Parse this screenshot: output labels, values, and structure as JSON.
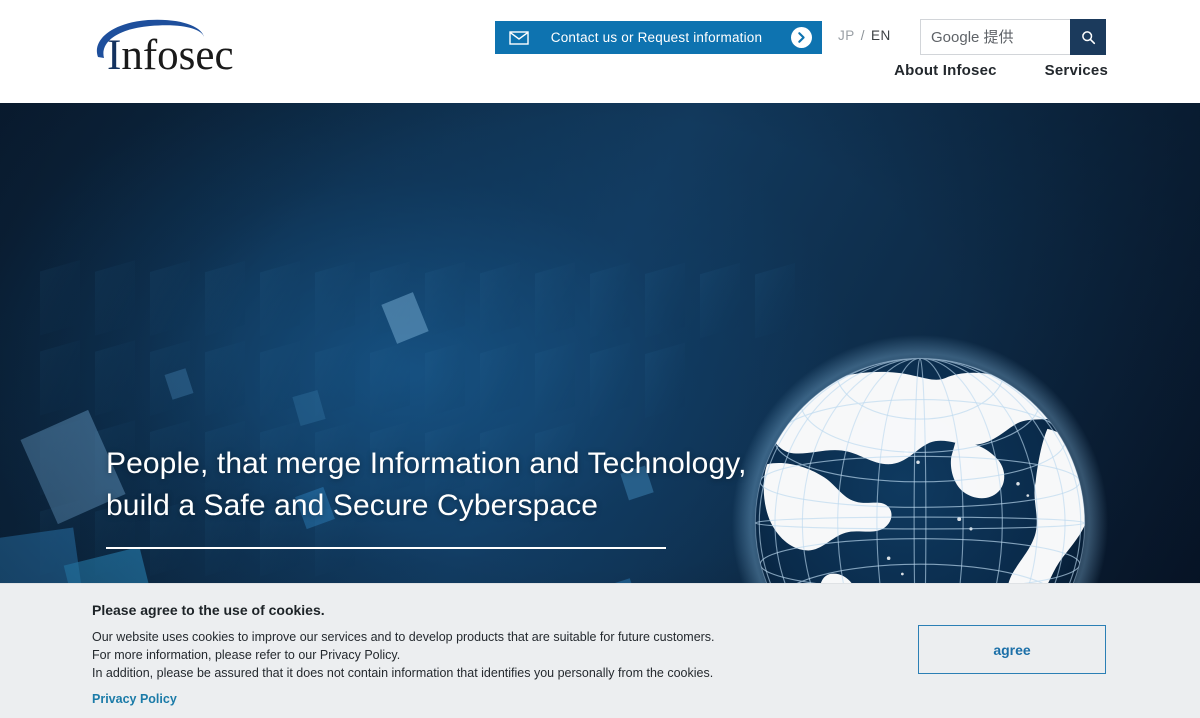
{
  "header": {
    "logo": {
      "text_lead": "I",
      "text_rest": "nfosec",
      "full": "Infosec"
    },
    "contact": {
      "label": "Contact us or Request information",
      "mail_icon": "envelope-icon",
      "arrow_icon": "circle-arrow-right-icon"
    },
    "language": {
      "jp": "JP",
      "separator": "/",
      "en": "EN",
      "active": "EN"
    },
    "search": {
      "placeholder": "Google 提供",
      "value": "",
      "icon": "search-icon"
    },
    "nav": [
      {
        "label": "About Infosec"
      },
      {
        "label": "Services"
      }
    ]
  },
  "hero": {
    "headline_line1": "People, that merge Information and Technology,",
    "headline_line2": "build a Safe and Secure Cyberspace",
    "globe_icon": "globe-wireframe-icon"
  },
  "cookie": {
    "title": "Please agree to the use of cookies.",
    "body_line1": "Our website uses cookies to improve our services and to develop products that are suitable for future customers.",
    "body_line2": "For more information, please refer to our Privacy Policy.",
    "body_line3": "In addition, please be assured that it does not contain information that identifies you personally from the cookies.",
    "privacy_link": "Privacy Policy",
    "agree_label": "agree"
  },
  "colors": {
    "contact_blue": "#0e73b0",
    "search_btn_navy": "#1b3a5c",
    "link_blue": "#1b7ba8",
    "agree_border": "#2b7fb5",
    "banner_bg": "#eceef0",
    "logo_blue": "#14325f"
  }
}
